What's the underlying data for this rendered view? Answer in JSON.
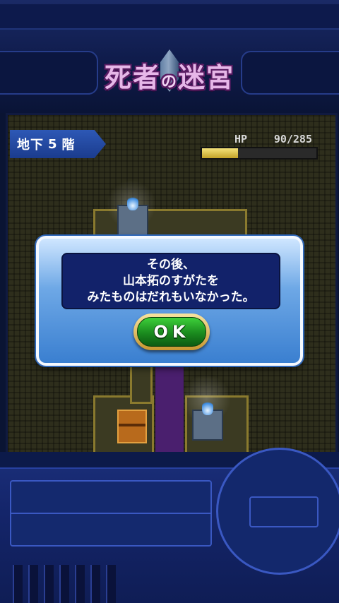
{
  "header": {
    "title_main": "死者",
    "title_particle": "の",
    "title_end": "迷宮"
  },
  "status": {
    "floor": {
      "prefix": "地下",
      "number": "5",
      "suffix": "階"
    },
    "hp": {
      "label": "HP",
      "value": "90/285",
      "current": 90,
      "max": 285
    }
  },
  "dialog": {
    "lines": [
      "その後、",
      "山本拓のすがたを",
      "みたものはだれもいなかった。"
    ],
    "ok_label": "OK"
  },
  "colors": {
    "frame": "#14256a",
    "dialog_blue": "#3a7fd0",
    "ok_green": "#1a8a1e",
    "hp_fill": "#c2a228"
  }
}
